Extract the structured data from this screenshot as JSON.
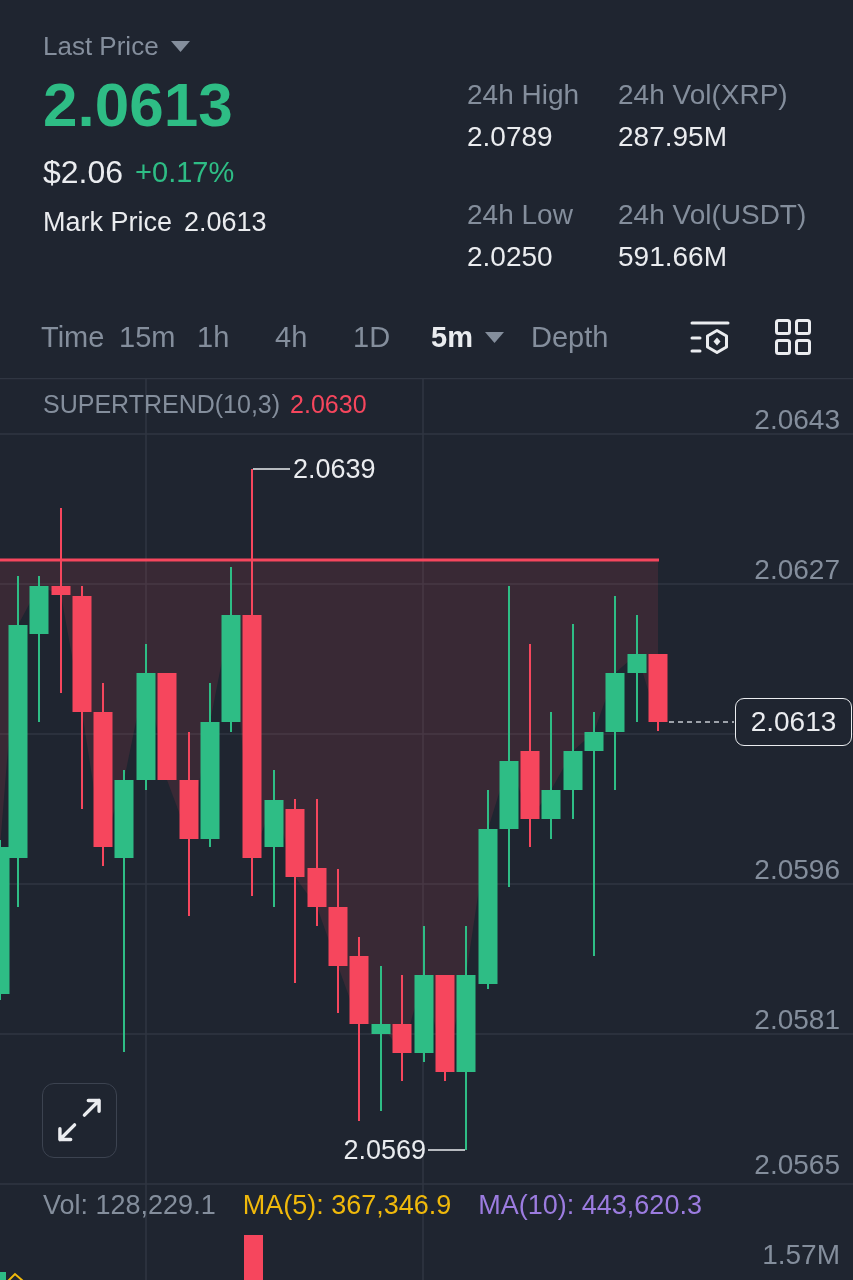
{
  "header": {
    "price_selector": "Last Price",
    "last_price": "2.0613",
    "usd_price": "$2.06",
    "change": "+0.17%",
    "mark_price_label": "Mark Price",
    "mark_price": "2.0613"
  },
  "stats": [
    {
      "label": "24h High",
      "value": "2.0789"
    },
    {
      "label": "24h Vol(XRP)",
      "value": "287.95M"
    },
    {
      "label": "24h Low",
      "value": "2.0250"
    },
    {
      "label": "24h Vol(USDT)",
      "value": "591.66M"
    }
  ],
  "intervals": [
    {
      "label": "Time",
      "selected": false,
      "dropdown": false
    },
    {
      "label": "15m",
      "selected": false,
      "dropdown": false
    },
    {
      "label": "1h",
      "selected": false,
      "dropdown": false
    },
    {
      "label": "4h",
      "selected": false,
      "dropdown": false
    },
    {
      "label": "1D",
      "selected": false,
      "dropdown": false
    },
    {
      "label": "5m",
      "selected": true,
      "dropdown": true
    },
    {
      "label": "Depth",
      "selected": false,
      "dropdown": false
    }
  ],
  "chart": {
    "indicator": {
      "name": "SUPERTREND(10,3)",
      "value": "2.0630"
    },
    "price_axis": [
      "2.0643",
      "2.0627",
      "2.0596",
      "2.0581",
      "2.0565"
    ],
    "high_marker": "2.0639",
    "low_marker": "2.0569",
    "current_price": "2.0613"
  },
  "volume": {
    "vol": "Vol: 128,229.1",
    "ma5": "MA(5): 367,346.9",
    "ma10": "MA(10): 443,620.3",
    "axis_label": "1.57M"
  }
}
